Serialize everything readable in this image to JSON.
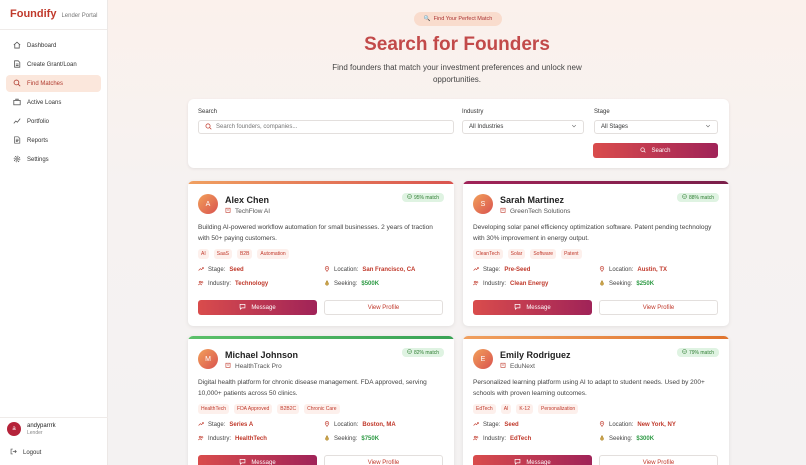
{
  "brand": {
    "name": "Foundify",
    "subtitle": "Lender Portal"
  },
  "sidebar": {
    "items": [
      {
        "label": "Dashboard",
        "icon": "home-icon"
      },
      {
        "label": "Create Grant/Loan",
        "icon": "document-icon"
      },
      {
        "label": "Find Matches",
        "icon": "search-icon",
        "active": true
      },
      {
        "label": "Active Loans",
        "icon": "briefcase-icon"
      },
      {
        "label": "Portfolio",
        "icon": "chart-icon"
      },
      {
        "label": "Reports",
        "icon": "report-icon"
      },
      {
        "label": "Settings",
        "icon": "gear-icon"
      }
    ],
    "user": {
      "initial": "a",
      "name": "andyparrrk",
      "role": "Lender"
    },
    "logout_label": "Logout"
  },
  "hero": {
    "pill": "Find Your Perfect Match",
    "title": "Search for Founders",
    "subtitle": "Find founders that match your investment preferences and unlock new opportunities."
  },
  "search": {
    "search_label": "Search",
    "placeholder": "Search founders, companies...",
    "industry_label": "Industry",
    "industry_value": "All Industries",
    "stage_label": "Stage",
    "stage_value": "All Stages",
    "button_label": "Search"
  },
  "labels": {
    "stage": "Stage:",
    "industry": "Industry:",
    "location": "Location:",
    "seeking": "Seeking:",
    "message": "Message",
    "view_profile": "View Profile"
  },
  "colors": {
    "accent": "#c24a4a",
    "gradient_start": "#d94c4c",
    "gradient_end": "#a02358",
    "match_green": "#2e7d32"
  },
  "cards": [
    {
      "initial": "A",
      "name": "Alex Chen",
      "company": "TechFlow AI",
      "match": "95% match",
      "description": "Building AI-powered workflow automation for small businesses. 2 years of traction with 50+ paying customers.",
      "tags": [
        "AI",
        "SaaS",
        "B2B",
        "Automation"
      ],
      "stage": "Seed",
      "industry": "Technology",
      "location": "San Francisco, CA",
      "seeking": "$500K",
      "bar_color": "linear-gradient(90deg, #f0a060, #d9534f)"
    },
    {
      "initial": "S",
      "name": "Sarah Martinez",
      "company": "GreenTech Solutions",
      "match": "88% match",
      "description": "Developing solar panel efficiency optimization software. Patent pending technology with 30% improvement in energy output.",
      "tags": [
        "CleanTech",
        "Solar",
        "Software",
        "Patent"
      ],
      "stage": "Pre-Seed",
      "industry": "Clean Energy",
      "location": "Austin, TX",
      "seeking": "$250K",
      "bar_color": "linear-gradient(90deg, #a02358, #7a1f4a)"
    },
    {
      "initial": "M",
      "name": "Michael Johnson",
      "company": "HealthTrack Pro",
      "match": "82% match",
      "description": "Digital health platform for chronic disease management. FDA approved, serving 10,000+ patients across 50 clinics.",
      "tags": [
        "HealthTech",
        "FDA Approved",
        "B2B2C",
        "Chronic Care"
      ],
      "stage": "Series A",
      "industry": "HealthTech",
      "location": "Boston, MA",
      "seeking": "$750K",
      "bar_color": "linear-gradient(90deg, #5cc06a, #3aa356)"
    },
    {
      "initial": "E",
      "name": "Emily Rodriguez",
      "company": "EduNext",
      "match": "79% match",
      "description": "Personalized learning platform using AI to adapt to student needs. Used by 200+ schools with proven learning outcomes.",
      "tags": [
        "EdTech",
        "AI",
        "K-12",
        "Personalization"
      ],
      "stage": "Seed",
      "industry": "EdTech",
      "location": "New York, NY",
      "seeking": "$300K",
      "bar_color": "linear-gradient(90deg, #f0a060, #e0752f)"
    }
  ]
}
